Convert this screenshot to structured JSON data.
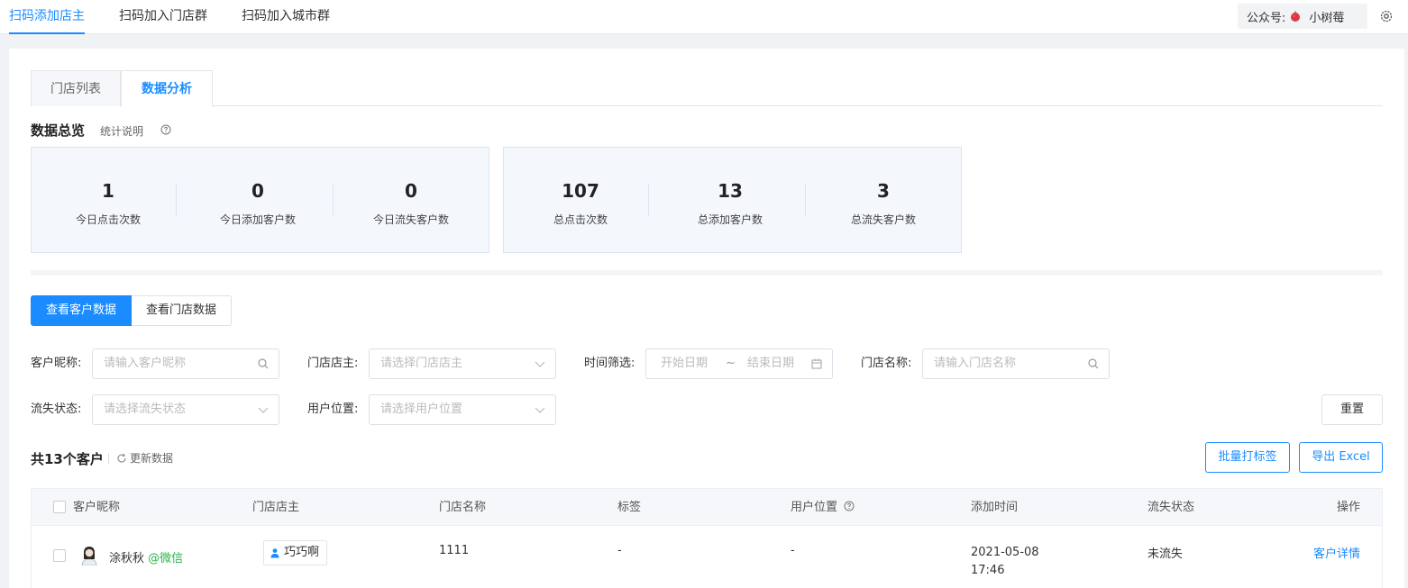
{
  "topnav": {
    "tabs": [
      {
        "label": "扫码添加店主",
        "active": true
      },
      {
        "label": "扫码加入门店群",
        "active": false
      },
      {
        "label": "扫码加入城市群",
        "active": false
      }
    ],
    "account_prefix": "公众号:",
    "account_name": "小树莓"
  },
  "subtabs": [
    "门店列表",
    "数据分析"
  ],
  "overview": {
    "title": "数据总览",
    "desc": "统计说明",
    "today": [
      {
        "value": "1",
        "label": "今日点击次数"
      },
      {
        "value": "0",
        "label": "今日添加客户数"
      },
      {
        "value": "0",
        "label": "今日流失客户数"
      }
    ],
    "total": [
      {
        "value": "107",
        "label": "总点击次数"
      },
      {
        "value": "13",
        "label": "总添加客户数"
      },
      {
        "value": "3",
        "label": "总流失客户数"
      }
    ]
  },
  "view_toggle": {
    "customer": "查看客户数据",
    "store": "查看门店数据"
  },
  "filters": {
    "nickname_label": "客户昵称:",
    "nickname_placeholder": "请输入客户昵称",
    "owner_label": "门店店主:",
    "owner_placeholder": "请选择门店店主",
    "time_label": "时间筛选:",
    "start_placeholder": "开始日期",
    "date_sep": "~",
    "end_placeholder": "结束日期",
    "store_label": "门店名称:",
    "store_placeholder": "请输入门店名称",
    "churn_label": "流失状态:",
    "churn_placeholder": "请选择流失状态",
    "location_label": "用户位置:",
    "location_placeholder": "请选择用户位置",
    "reset": "重置"
  },
  "list": {
    "title": "共13个客户",
    "refresh": "更新数据",
    "batch_tag": "批量打标签",
    "export": "导出 Excel"
  },
  "table": {
    "headers": [
      "客户昵称",
      "门店店主",
      "门店名称",
      "标签",
      "用户位置",
      "添加时间",
      "流失状态",
      "操作"
    ],
    "rows": [
      {
        "nickname": "涂秋秋",
        "source": "@微信",
        "owner": "巧巧啊",
        "store": "1111",
        "tag": "-",
        "location": "-",
        "date": "2021-05-08",
        "time": "17:46",
        "status": "未流失",
        "action": "客户详情"
      }
    ]
  },
  "colors": {
    "accent": "#1a8cff",
    "wechat": "#2bb24c"
  }
}
